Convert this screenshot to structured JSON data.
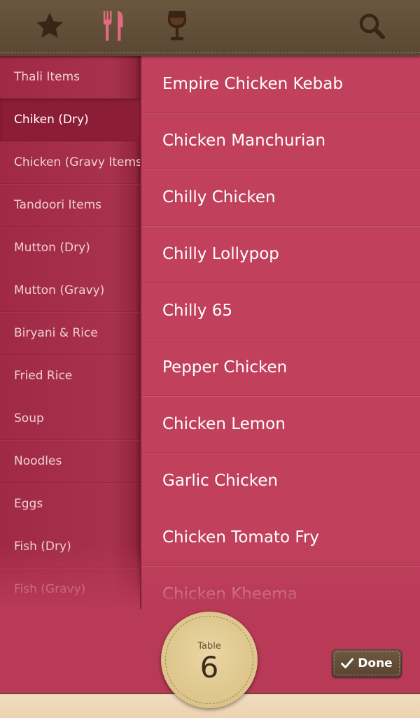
{
  "toolbar": {
    "icons": [
      "star-icon",
      "cutlery-icon",
      "wine-glass-icon",
      "search-icon"
    ],
    "active_icon": "cutlery-icon",
    "colors": {
      "icon": "#3a2416",
      "active": "#e26b7d"
    }
  },
  "categories": [
    {
      "label": "Thali Items"
    },
    {
      "label": "Chiken (Dry)"
    },
    {
      "label": "Chicken (Gravy Items)"
    },
    {
      "label": "Tandoori Items"
    },
    {
      "label": "Mutton (Dry)"
    },
    {
      "label": "Mutton (Gravy)"
    },
    {
      "label": "Biryani & Rice"
    },
    {
      "label": "Fried Rice"
    },
    {
      "label": "Soup"
    },
    {
      "label": "Noodles"
    },
    {
      "label": "Eggs"
    },
    {
      "label": "Fish (Dry)"
    },
    {
      "label": "Fish (Gravy)"
    }
  ],
  "selected_category": "Chiken (Dry)",
  "items": [
    {
      "label": "Empire Chicken Kebab"
    },
    {
      "label": "Chicken Manchurian"
    },
    {
      "label": "Chilly Chicken"
    },
    {
      "label": "Chilly Lollypop"
    },
    {
      "label": "Chilly 65"
    },
    {
      "label": "Pepper Chicken"
    },
    {
      "label": "Chicken Lemon"
    },
    {
      "label": "Garlic Chicken"
    },
    {
      "label": "Chicken Tomato Fry"
    },
    {
      "label": "Chicken Kheema"
    }
  ],
  "table": {
    "label": "Table",
    "number": "6"
  },
  "done": {
    "label": "Done"
  }
}
